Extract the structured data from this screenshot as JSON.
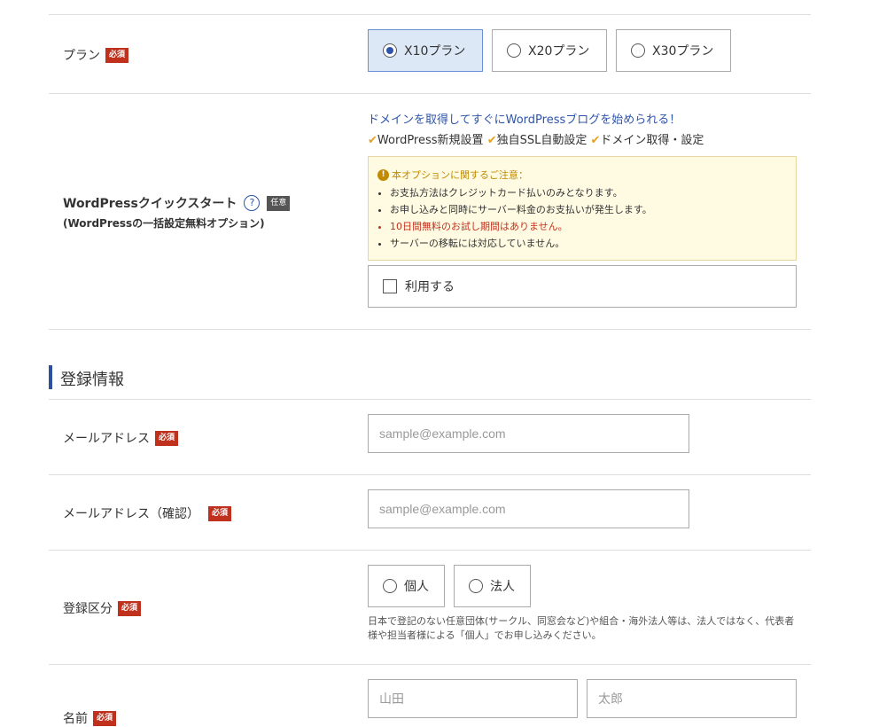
{
  "plan": {
    "label": "プラン",
    "required_badge": "必須",
    "options": [
      {
        "label": "X10プラン",
        "selected": true
      },
      {
        "label": "X20プラン",
        "selected": false
      },
      {
        "label": "X30プラン",
        "selected": false
      }
    ]
  },
  "wp_quickstart": {
    "label": "WordPressクイックスタート",
    "sublabel": "(WordPressの一括設定無料オプション)",
    "optional_badge": "任意",
    "help_icon": "?",
    "promo": "ドメインを取得してすぐにWordPressブログを始められる！",
    "features": [
      "WordPress新規設置",
      "独自SSL自動設定",
      "ドメイン取得・設定"
    ],
    "notice_title": "本オプションに関するご注意：",
    "notice_items": [
      "お支払方法はクレジットカード払いのみとなります。",
      "お申し込みと同時にサーバー料金のお支払いが発生します。",
      "10日間無料のお試し期間はありません。",
      "サーバーの移転には対応していません。"
    ],
    "checkbox_label": "利用する",
    "checked": false
  },
  "registration": {
    "section_title": "登録情報",
    "email": {
      "label": "メールアドレス",
      "badge": "必須",
      "placeholder": "sample@example.com"
    },
    "email_confirm": {
      "label": "メールアドレス（確認）",
      "badge": "必須",
      "placeholder": "sample@example.com"
    },
    "category": {
      "label": "登録区分",
      "badge": "必須",
      "options": [
        "個人",
        "法人"
      ],
      "note": "日本で登記のない任意団体(サークル、同窓会など)や組合・海外法人等は、法人ではなく、代表者様や担当者様による「個人」でお申し込みください。"
    },
    "name": {
      "label": "名前",
      "badge": "必須",
      "last_placeholder": "山田",
      "first_placeholder": "太郎"
    }
  },
  "colors": {
    "accent": "#2e4f9e",
    "required": "#c0311d",
    "check": "#e6a21f",
    "notice_bg": "#fffbe3",
    "danger_text": "#c0311d"
  },
  "icons": {
    "help": "question-circle-icon",
    "warning": "exclamation-circle-icon",
    "check": "checkmark-icon"
  }
}
